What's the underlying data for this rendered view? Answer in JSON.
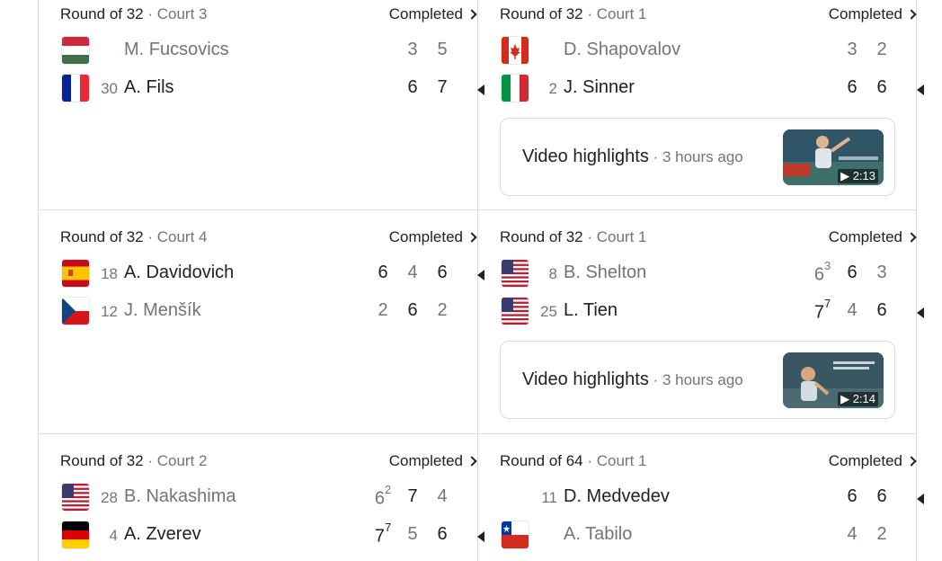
{
  "matches": [
    {
      "round": "Round of 32",
      "court": "Court 3",
      "status": "Completed",
      "players": [
        {
          "seed": "",
          "name": "M. Fucsovics",
          "flag": "hungary",
          "scores": [
            {
              "v": "3",
              "t": ""
            },
            {
              "v": "5",
              "t": ""
            }
          ],
          "winner": false
        },
        {
          "seed": "30",
          "name": "A. Fils",
          "flag": "france",
          "scores": [
            {
              "v": "6",
              "t": ""
            },
            {
              "v": "7",
              "t": ""
            }
          ],
          "winner": true
        }
      ]
    },
    {
      "round": "Round of 32",
      "court": "Court 1",
      "status": "Completed",
      "players": [
        {
          "seed": "",
          "name": "D. Shapovalov",
          "flag": "canada",
          "scores": [
            {
              "v": "3",
              "t": ""
            },
            {
              "v": "2",
              "t": ""
            }
          ],
          "winner": false
        },
        {
          "seed": "2",
          "name": "J. Sinner",
          "flag": "italy",
          "scores": [
            {
              "v": "6",
              "t": ""
            },
            {
              "v": "6",
              "t": ""
            }
          ],
          "winner": true
        }
      ],
      "video": {
        "label": "Video highlights",
        "time": "3 hours ago",
        "duration": "2:13"
      }
    },
    {
      "round": "Round of 32",
      "court": "Court 4",
      "status": "Completed",
      "players": [
        {
          "seed": "18",
          "name": "A. Davidovich",
          "flag": "spain",
          "scores": [
            {
              "v": "6",
              "t": ""
            },
            {
              "v": "4",
              "t": ""
            },
            {
              "v": "6",
              "t": ""
            }
          ],
          "winner": true
        },
        {
          "seed": "12",
          "name": "J. Menšík",
          "flag": "czech",
          "scores": [
            {
              "v": "2",
              "t": ""
            },
            {
              "v": "6",
              "t": ""
            },
            {
              "v": "2",
              "t": ""
            }
          ],
          "winner": false
        }
      ]
    },
    {
      "round": "Round of 32",
      "court": "Court 1",
      "status": "Completed",
      "players": [
        {
          "seed": "8",
          "name": "B. Shelton",
          "flag": "usa",
          "scores": [
            {
              "v": "6",
              "t": "3"
            },
            {
              "v": "6",
              "t": ""
            },
            {
              "v": "3",
              "t": ""
            }
          ],
          "winner": false
        },
        {
          "seed": "25",
          "name": "L. Tien",
          "flag": "usa",
          "scores": [
            {
              "v": "7",
              "t": "7"
            },
            {
              "v": "4",
              "t": ""
            },
            {
              "v": "6",
              "t": ""
            }
          ],
          "winner": true
        }
      ],
      "video": {
        "label": "Video highlights",
        "time": "3 hours ago",
        "duration": "2:14"
      }
    },
    {
      "round": "Round of 32",
      "court": "Court 2",
      "status": "Completed",
      "players": [
        {
          "seed": "28",
          "name": "B. Nakashima",
          "flag": "usa",
          "scores": [
            {
              "v": "6",
              "t": "2"
            },
            {
              "v": "7",
              "t": ""
            },
            {
              "v": "4",
              "t": ""
            }
          ],
          "winner": false
        },
        {
          "seed": "4",
          "name": "A. Zverev",
          "flag": "germany",
          "scores": [
            {
              "v": "7",
              "t": "7"
            },
            {
              "v": "5",
              "t": ""
            },
            {
              "v": "6",
              "t": ""
            }
          ],
          "winner": true
        }
      ]
    },
    {
      "round": "Round of 64",
      "court": "Court 1",
      "status": "Completed",
      "players": [
        {
          "seed": "11",
          "name": "D. Medvedev",
          "flag": "",
          "scores": [
            {
              "v": "6",
              "t": ""
            },
            {
              "v": "6",
              "t": ""
            }
          ],
          "winner": true
        },
        {
          "seed": "",
          "name": "A. Tabilo",
          "flag": "chile",
          "scores": [
            {
              "v": "4",
              "t": ""
            },
            {
              "v": "2",
              "t": ""
            }
          ],
          "winner": false
        }
      ]
    }
  ],
  "colors": {
    "text": "#202124",
    "muted": "#70757a",
    "divider": "#dadce0"
  }
}
